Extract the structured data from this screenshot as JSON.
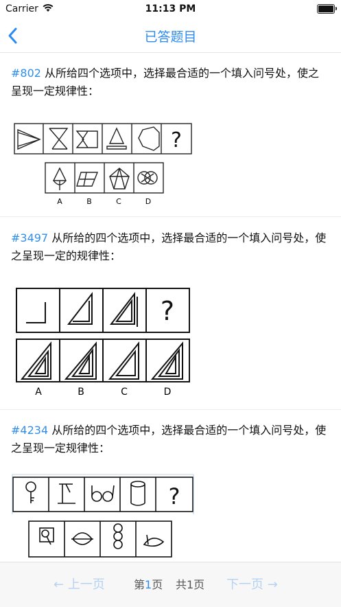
{
  "status_bar": {
    "carrier": "Carrier",
    "time": "11:13 PM"
  },
  "nav": {
    "title": "已答题目"
  },
  "questions": [
    {
      "num": "#802",
      "text": " 从所给四个选项中，选择最合适的一个填入问号处，使之呈现一定规律性：",
      "question_mark": "?",
      "options": [
        "A",
        "B",
        "C",
        "D"
      ]
    },
    {
      "num": "#3497",
      "text": " 从所给的四个选项中，选择最合适的一个填入问号处，使之呈现一定的规律性：",
      "question_mark": "?",
      "options": [
        "A",
        "B",
        "C",
        "D"
      ]
    },
    {
      "num": "#4234",
      "text": " 从所给的四个选项中，选择最合适的一个填入问号处，使之呈现一定规律性：",
      "question_mark": "?"
    }
  ],
  "pagination": {
    "prev": "← 上一页",
    "page_prefix": "第",
    "page_current": "1",
    "page_suffix": "页",
    "total": "共1页",
    "next": "下一页 →"
  }
}
